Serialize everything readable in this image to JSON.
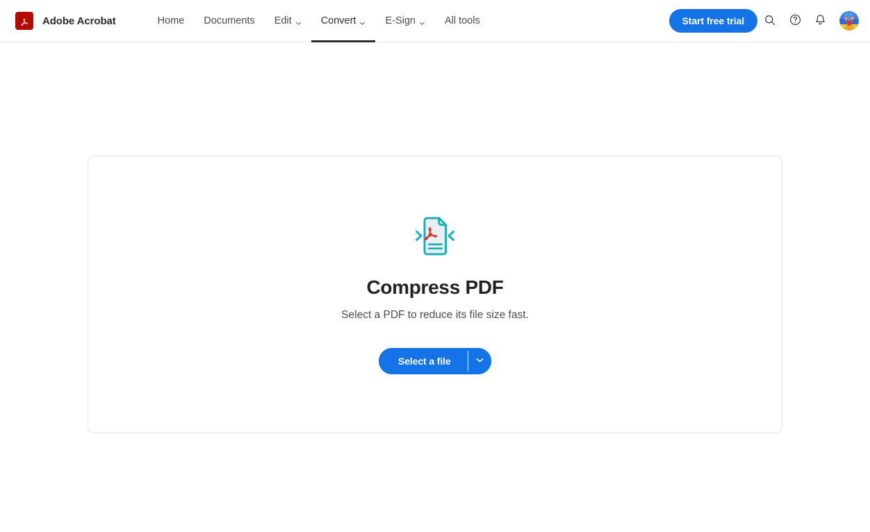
{
  "header": {
    "brand": {
      "logo_icon": "adobe-acrobat-logo-icon",
      "name": "Adobe Acrobat",
      "logo_color": "#b30b00"
    },
    "nav": [
      {
        "label": "Home",
        "has_caret": false,
        "active": false,
        "icon": ""
      },
      {
        "label": "Documents",
        "has_caret": false,
        "active": false,
        "icon": ""
      },
      {
        "label": "Edit",
        "has_caret": true,
        "active": false,
        "icon": "chevron-down-icon"
      },
      {
        "label": "Convert",
        "has_caret": true,
        "active": true,
        "icon": "chevron-down-icon"
      },
      {
        "label": "E-Sign",
        "has_caret": true,
        "active": false,
        "icon": "chevron-down-icon"
      },
      {
        "label": "All tools",
        "has_caret": false,
        "active": false,
        "icon": ""
      }
    ],
    "trial_button": {
      "label": "Start free trial",
      "color": "#1473e6"
    },
    "actions": [
      {
        "name": "search-icon",
        "title": "Search"
      },
      {
        "name": "help-circle-icon",
        "title": "Help"
      },
      {
        "name": "notification-bell-icon",
        "title": "Notifications"
      }
    ],
    "avatar": {
      "name": "user-avatar",
      "title": "Account"
    }
  },
  "main": {
    "dropzone": {
      "file_icon": "compress-pdf-file-icon",
      "title": "Compress PDF",
      "subtitle": "Select a PDF to reduce its file size fast.",
      "select_button": {
        "label": "Select a file",
        "caret_icon": "chevron-down-icon",
        "color": "#1473e6"
      },
      "border_color": "#e4e4e4"
    }
  },
  "colors": {
    "accent_blue": "#1473e6",
    "adobe_red": "#b30b00",
    "icon_teal": "#1bafb9",
    "icon_fill": "#e8eff0",
    "text_primary": "#222222",
    "text_secondary": "#4b4b4b"
  }
}
